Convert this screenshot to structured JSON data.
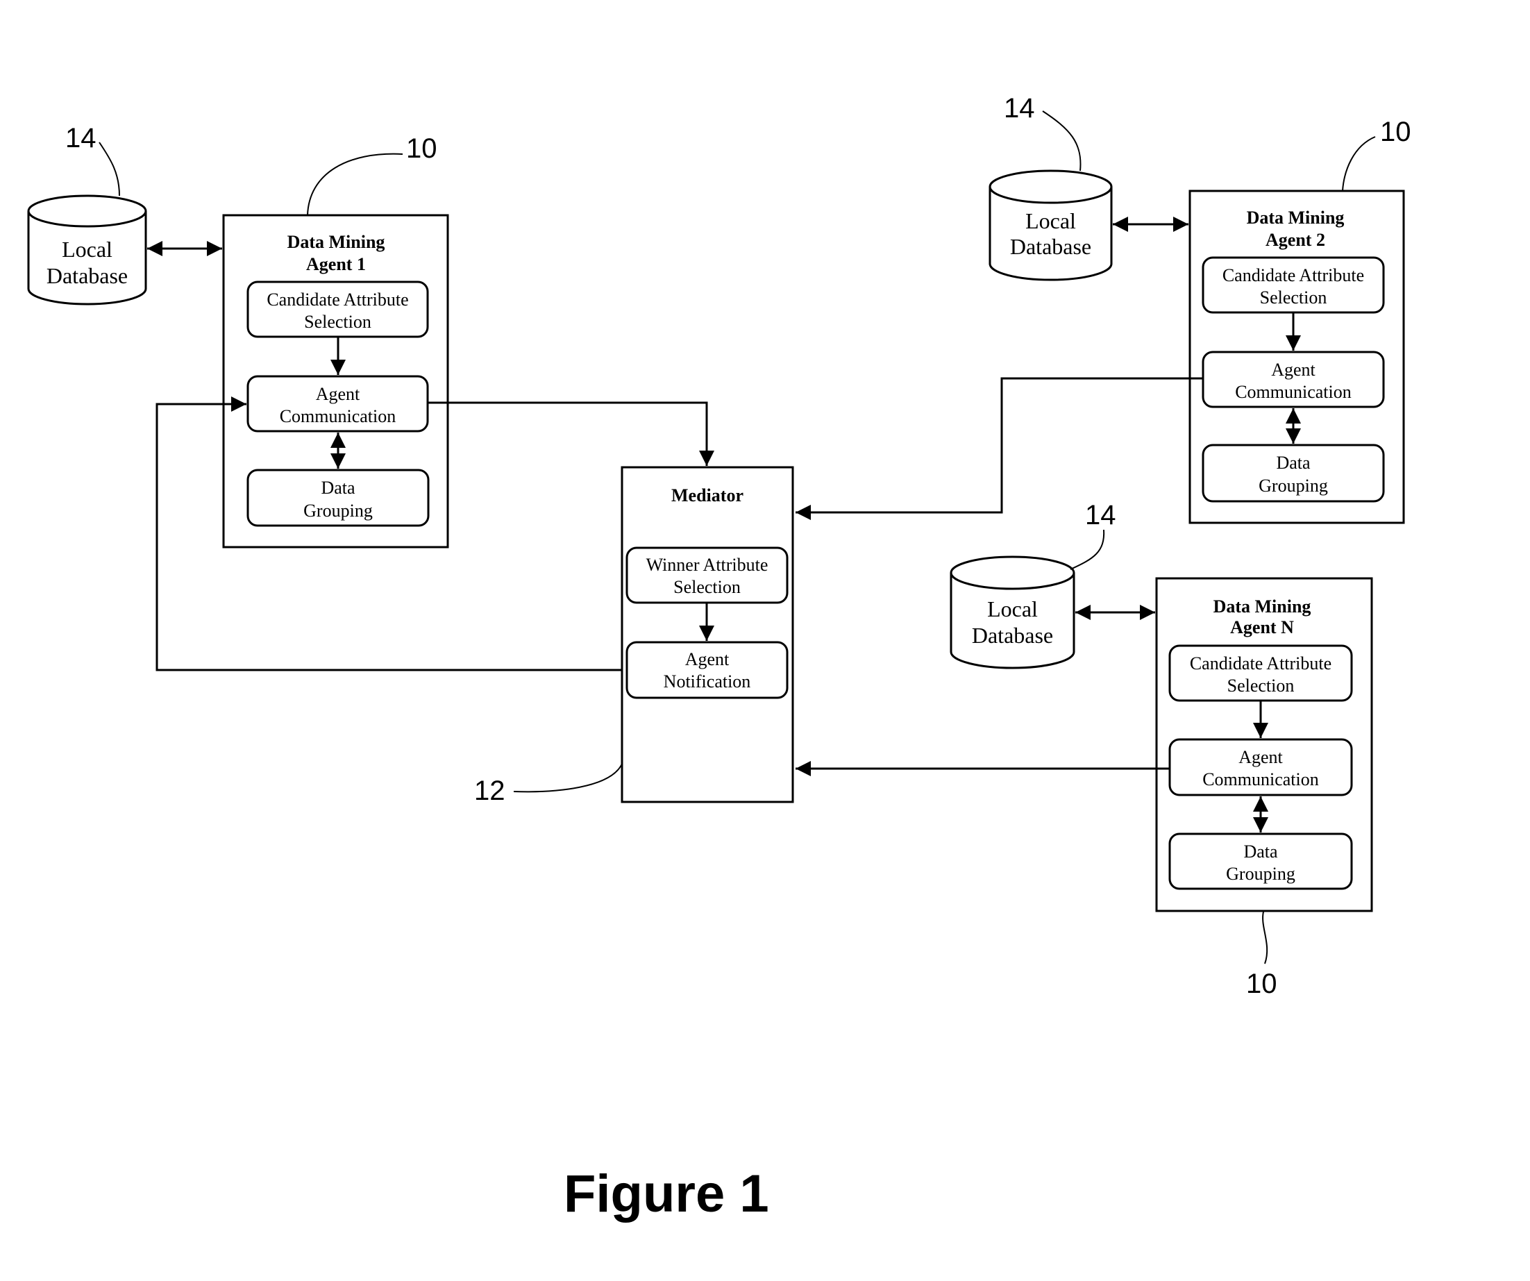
{
  "figure_caption": "Figure 1",
  "ref_labels": {
    "agent": "10",
    "mediator": "12",
    "database": "14"
  },
  "database": {
    "line1": "Local",
    "line2": "Database"
  },
  "agents": [
    {
      "title_line1": "Data Mining",
      "title_line2": "Agent 1",
      "modules": [
        {
          "line1": "Candidate Attribute",
          "line2": "Selection"
        },
        {
          "line1": "Agent",
          "line2": "Communication"
        },
        {
          "line1": "Data",
          "line2": "Grouping"
        }
      ]
    },
    {
      "title_line1": "Data Mining",
      "title_line2": "Agent 2",
      "modules": [
        {
          "line1": "Candidate Attribute",
          "line2": "Selection"
        },
        {
          "line1": "Agent",
          "line2": "Communication"
        },
        {
          "line1": "Data",
          "line2": "Grouping"
        }
      ]
    },
    {
      "title_line1": "Data Mining",
      "title_line2": "Agent N",
      "modules": [
        {
          "line1": "Candidate Attribute",
          "line2": "Selection"
        },
        {
          "line1": "Agent",
          "line2": "Communication"
        },
        {
          "line1": "Data",
          "line2": "Grouping"
        }
      ]
    }
  ],
  "mediator": {
    "title": "Mediator",
    "modules": [
      {
        "line1": "Winner Attribute",
        "line2": "Selection"
      },
      {
        "line1": "Agent",
        "line2": "Notification"
      }
    ]
  }
}
